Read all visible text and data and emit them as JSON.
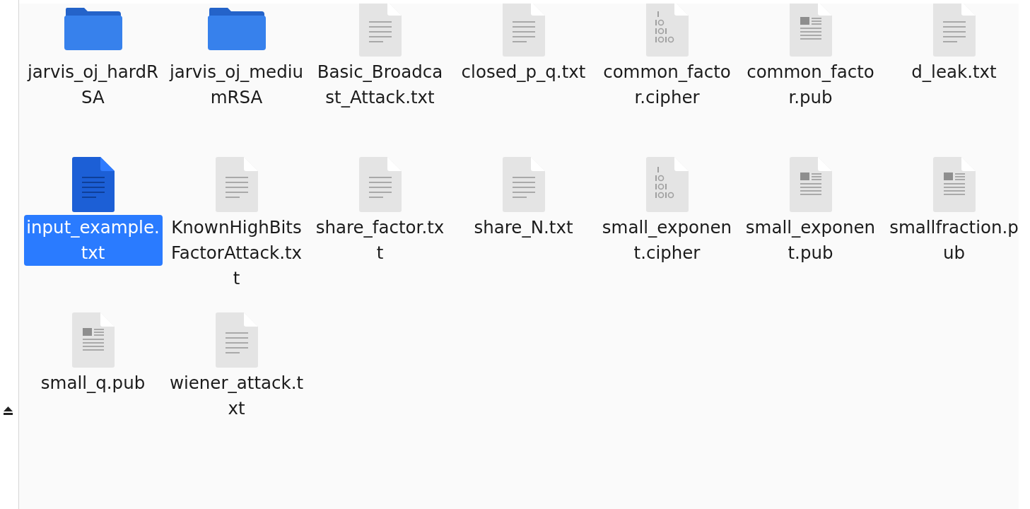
{
  "files": [
    {
      "name": "jarvis_oj_hardRSA",
      "kind": "folder",
      "selected": false
    },
    {
      "name": "jarvis_oj_mediumRSA",
      "kind": "folder",
      "selected": false
    },
    {
      "name": "Basic_Broadcast_Attack.txt",
      "kind": "text",
      "selected": false
    },
    {
      "name": "closed_p_q.txt",
      "kind": "text",
      "selected": false
    },
    {
      "name": "common_factor.cipher",
      "kind": "binary",
      "selected": false
    },
    {
      "name": "common_factor.pub",
      "kind": "pub",
      "selected": false
    },
    {
      "name": "d_leak.txt",
      "kind": "text",
      "selected": false
    },
    {
      "name": "input_example.txt",
      "kind": "text",
      "selected": true
    },
    {
      "name": "KnownHighBitsFactorAttack.txt",
      "kind": "text",
      "selected": false
    },
    {
      "name": "share_factor.txt",
      "kind": "text",
      "selected": false
    },
    {
      "name": "share_N.txt",
      "kind": "text",
      "selected": false
    },
    {
      "name": "small_exponent.cipher",
      "kind": "binary",
      "selected": false
    },
    {
      "name": "small_exponent.pub",
      "kind": "pub",
      "selected": false
    },
    {
      "name": "smallfraction.pub",
      "kind": "pub",
      "selected": false
    },
    {
      "name": "small_q.pub",
      "kind": "pub",
      "selected": false
    },
    {
      "name": "wiener_attack.txt",
      "kind": "text",
      "selected": false
    }
  ]
}
